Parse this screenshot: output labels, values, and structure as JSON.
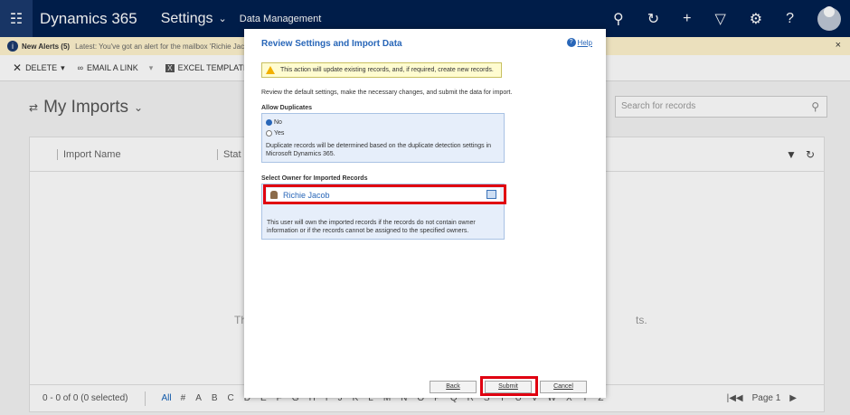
{
  "topbar": {
    "app_title": "Dynamics 365",
    "area": "Settings",
    "breadcrumb": "Data Management",
    "icons": [
      "search-icon",
      "history-icon",
      "plus-icon",
      "filter-icon",
      "gear-icon",
      "help-icon",
      "avatar"
    ]
  },
  "alert": {
    "title": "New Alerts (5)",
    "text": "Latest: You've got an alert for the mailbox 'Richie Jacob'",
    "close": "×"
  },
  "commands": {
    "delete": "DELETE",
    "email_link": "EMAIL A LINK",
    "excel_templates": "EXCEL TEMPLATES"
  },
  "view": {
    "title": "My Imports",
    "search_placeholder": "Search for records",
    "columns": [
      "Import Name",
      "Stat"
    ],
    "empty_left": "Th",
    "empty_right": "ts.",
    "footer_count": "0 - 0 of 0 (0 selected)",
    "filter_all": "All",
    "letters": [
      "#",
      "A",
      "B",
      "C",
      "D",
      "E",
      "F",
      "G",
      "H",
      "I",
      "J",
      "K",
      "L",
      "M",
      "N",
      "O",
      "P",
      "Q",
      "R",
      "S",
      "T",
      "U",
      "V",
      "W",
      "X",
      "Y",
      "Z"
    ],
    "page": "Page 1"
  },
  "modal": {
    "title": "Review Settings and Import Data",
    "help": "Help",
    "warning": "This action will update existing records, and, if required, create new records.",
    "instructions": "Review the default settings, make the necessary changes, and submit the data for import.",
    "allow_duplicates_label": "Allow Duplicates",
    "option_no": "No",
    "option_yes": "Yes",
    "duplicate_note": "Duplicate records will be determined based on the duplicate detection settings in Microsoft Dynamics 365.",
    "owner_label": "Select Owner for Imported Records",
    "owner_value": "Richie Jacob",
    "owner_note": "This user will own the imported records if the records do not contain owner information or if the records cannot be assigned to the specified owners.",
    "back": "Back",
    "submit": "Submit",
    "cancel": "Cancel"
  },
  "colors": {
    "nav": "#002050",
    "accent": "#2866b8",
    "highlight": "#e00010",
    "alert_bg": "#fff4ce"
  }
}
